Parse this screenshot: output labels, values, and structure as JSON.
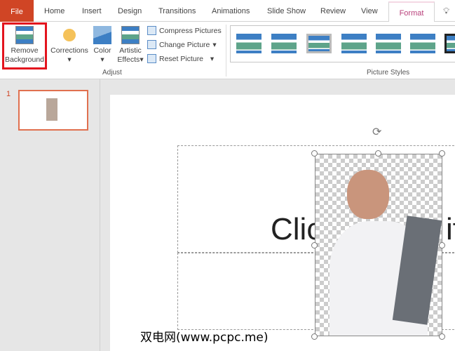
{
  "tabs": {
    "file": "File",
    "home": "Home",
    "insert": "Insert",
    "design": "Design",
    "transitions": "Transitions",
    "animations": "Animations",
    "slideshow": "Slide Show",
    "review": "Review",
    "view": "View",
    "format": "Format"
  },
  "adjust": {
    "remove_bg_1": "Remove",
    "remove_bg_2": "Background",
    "corrections": "Corrections",
    "color": "Color",
    "artistic_1": "Artistic",
    "artistic_2": "Effects",
    "compress": "Compress Pictures",
    "change": "Change Picture",
    "reset": "Reset Picture",
    "group": "Adjust"
  },
  "styles": {
    "group": "Picture Styles"
  },
  "slides": {
    "number": "1"
  },
  "slide": {
    "title": "Clic",
    "title_end": "it"
  },
  "watermark": "双电网(www.pcpc.me)"
}
